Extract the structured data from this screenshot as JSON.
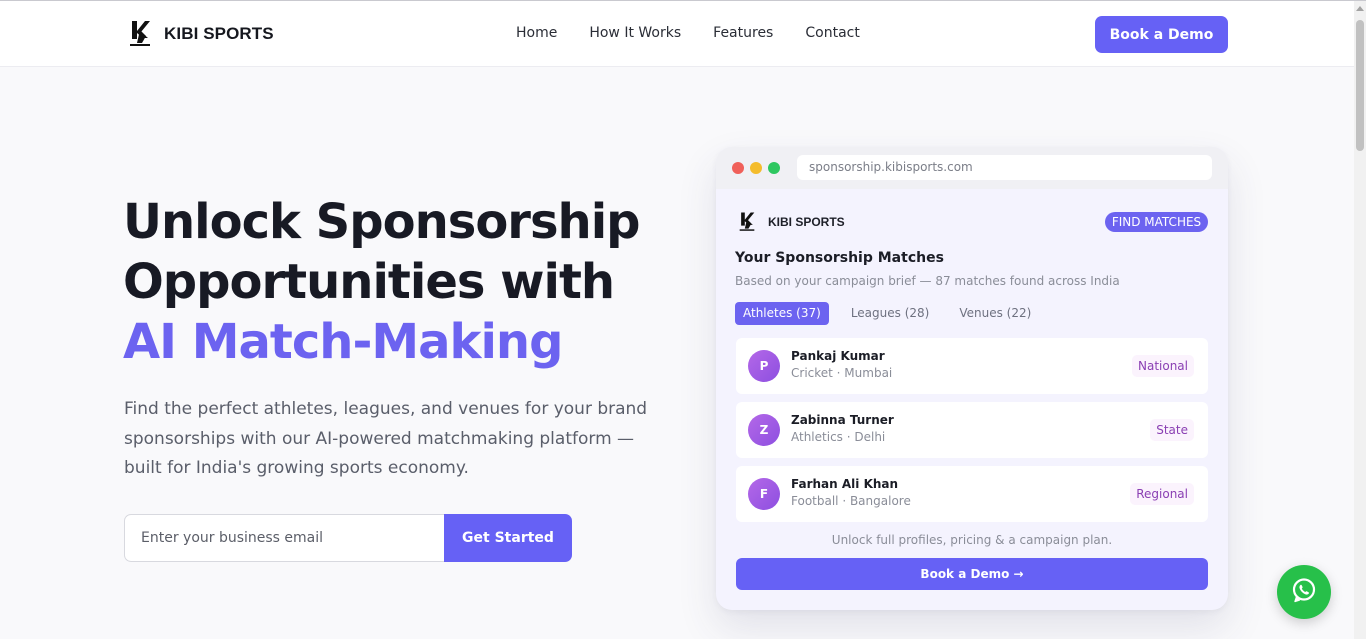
{
  "nav": {
    "brand": "KIBI SPORTS",
    "links": [
      "Home",
      "How It Works",
      "Features",
      "Contact"
    ],
    "cta": "Book a Demo"
  },
  "hero": {
    "title_line1": "Unlock Sponsorship",
    "title_line2": "Opportunities with",
    "title_accent": "AI Match-Making",
    "subtitle": "Find the perfect athletes, leagues, and venues for your brand sponsorships with our AI-powered matchmaking platform — built for India's growing sports economy.",
    "email_placeholder": "Enter your business email",
    "cta": "Get Started"
  },
  "mockup": {
    "url": "sponsorship.kibisports.com",
    "brand": "KIBI SPORTS",
    "badge": "FIND MATCHES",
    "title": "Your Sponsorship Matches",
    "subtitle": "Based on your campaign brief — 87 matches found across India",
    "tabs": [
      {
        "label": "Athletes (37)",
        "active": true
      },
      {
        "label": "Leagues (28)",
        "active": false
      },
      {
        "label": "Venues (22)",
        "active": false
      }
    ],
    "matches": [
      {
        "initial": "P",
        "name": "Pankaj Kumar",
        "meta": "Cricket · Mumbai",
        "tag": "National"
      },
      {
        "initial": "Z",
        "name": "Zabinna Turner",
        "meta": "Athletics · Delhi",
        "tag": "State"
      },
      {
        "initial": "F",
        "name": "Farhan Ali Khan",
        "meta": "Football · Bangalore",
        "tag": "Regional"
      }
    ],
    "unlock_note": "Unlock full profiles, pricing & a campaign plan.",
    "cta": "Book a Demo →"
  },
  "colors": {
    "accent": "#6661f5",
    "whatsapp": "#27c04a"
  },
  "icons": {
    "whatsapp": "whatsapp-icon",
    "logo": "kibi-logo-icon"
  }
}
